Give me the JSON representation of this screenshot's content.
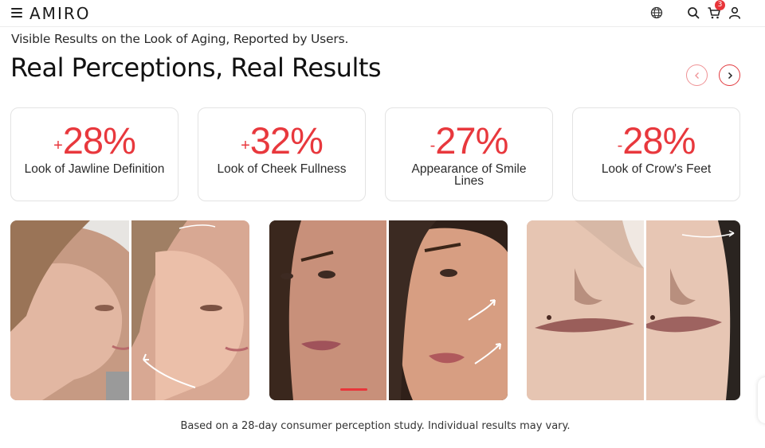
{
  "header": {
    "brand": "AMIRO",
    "cart_count": "3",
    "icons": [
      "menu-icon",
      "globe-icon",
      "search-icon",
      "cart-icon",
      "account-icon"
    ]
  },
  "intro": {
    "eyebrow": "Visible Results on the Look of Aging, Reported by Users.",
    "title": "Real Perceptions, Real Results"
  },
  "stats": [
    {
      "sign": "+",
      "value": "28%",
      "label": "Look of Jawline Definition"
    },
    {
      "sign": "+",
      "value": "32%",
      "label": "Look of Cheek Fullness"
    },
    {
      "sign": "-",
      "value": "27%",
      "label": "Appearance of Smile Lines"
    },
    {
      "sign": "-",
      "value": "28%",
      "label": "Look of Crow's Feet"
    }
  ],
  "gallery": {
    "items": [
      "jawline-before-after",
      "cheek-before-after",
      "smile-lines-before-after"
    ]
  },
  "disclaimer": "Based on a 28-day consumer perception study. Individual results may vary.",
  "colors": {
    "accent": "#e8383d",
    "text": "#1b1b1b",
    "border": "#e3e3e3"
  }
}
